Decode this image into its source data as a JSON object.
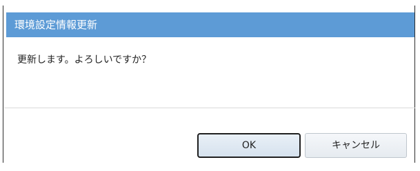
{
  "dialog": {
    "title": "環境設定情報更新",
    "message": "更新します。よろしいですか？",
    "ok_label": "OK",
    "cancel_label": "キャンセル"
  },
  "colors": {
    "titlebar": "#5d9bd6",
    "title_text": "#ffffff",
    "dialog_border": "#2b2b2b"
  }
}
